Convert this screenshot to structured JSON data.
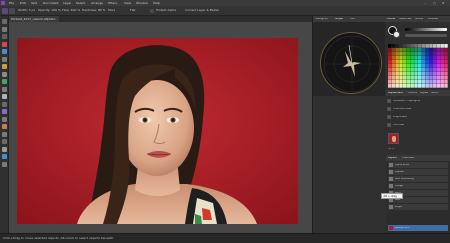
{
  "app": {
    "title": "Affinity Photo",
    "accent_color": "#8a3fc8"
  },
  "menubar": {
    "items": [
      "File",
      "Edit",
      "Text",
      "Document",
      "Layer",
      "Select",
      "Arrange",
      "Filters",
      "View",
      "Window",
      "Help"
    ],
    "window_controls": [
      "–",
      "▢",
      "✕"
    ]
  },
  "toolbar": {
    "items": [
      {
        "label": "Width: 3 px"
      },
      {
        "label": "Opacity: 100 %"
      },
      {
        "label": "Flow: 100 %"
      },
      {
        "label": "Hardness: 80 %"
      },
      {
        "label": "More"
      },
      {
        "label": "Flat"
      },
      {
        "label": "Protect Alpha"
      },
      {
        "label": "Current Layer & Below"
      }
    ]
  },
  "document_tab": {
    "label": "Portrait_2017_rework.afphoto"
  },
  "tools": {
    "icons": [
      "move-tool-icon",
      "view-tool-icon",
      "crop-tool-icon",
      "selection-brush-icon",
      "flood-select-icon",
      "marquee-icon",
      "paint-brush-icon",
      "erase-brush-icon",
      "fill-tool-icon",
      "clone-brush-icon",
      "dodge-brush-icon",
      "burn-brush-icon",
      "smudge-brush-icon",
      "blur-brush-icon",
      "inpainting-brush-icon",
      "pen-tool-icon",
      "shape-tool-icon",
      "text-tool-icon",
      "color-picker-icon",
      "zoom-tool-icon"
    ]
  },
  "right_panels": {
    "scope_tabs": [
      "Histogram",
      "Scope",
      "Info"
    ],
    "color_tabs": [
      "Colour",
      "Swatches",
      "Stroke",
      "Brushes"
    ],
    "adjust_tabs": [
      "Adjustment",
      "Effects",
      "Styles",
      "Stock"
    ],
    "adjustments": [
      "Shadows / Highlights",
      "Channel Mixer",
      "Brightness",
      "Contrast"
    ],
    "layers_tabs": [
      "Layers",
      "Channels"
    ],
    "layers": [
      {
        "name": "Eye & Brow",
        "selected": false
      },
      {
        "name": "Lighten",
        "selected": false
      },
      {
        "name": "Skin Smoothing",
        "selected": false
      },
      {
        "name": "Dodge",
        "selected": false
      },
      {
        "name": "Burn",
        "selected": false
      },
      {
        "name": "Skin",
        "selected": false
      },
      {
        "name": "Bright",
        "selected": false
      },
      {
        "name": "Background",
        "selected": true
      }
    ],
    "tooltip": "Alt + drag",
    "ruler_size": "50 %"
  },
  "statusbar": {
    "text": "Click+Drag to move selected objects. Alt+Click to select objects beneath."
  }
}
